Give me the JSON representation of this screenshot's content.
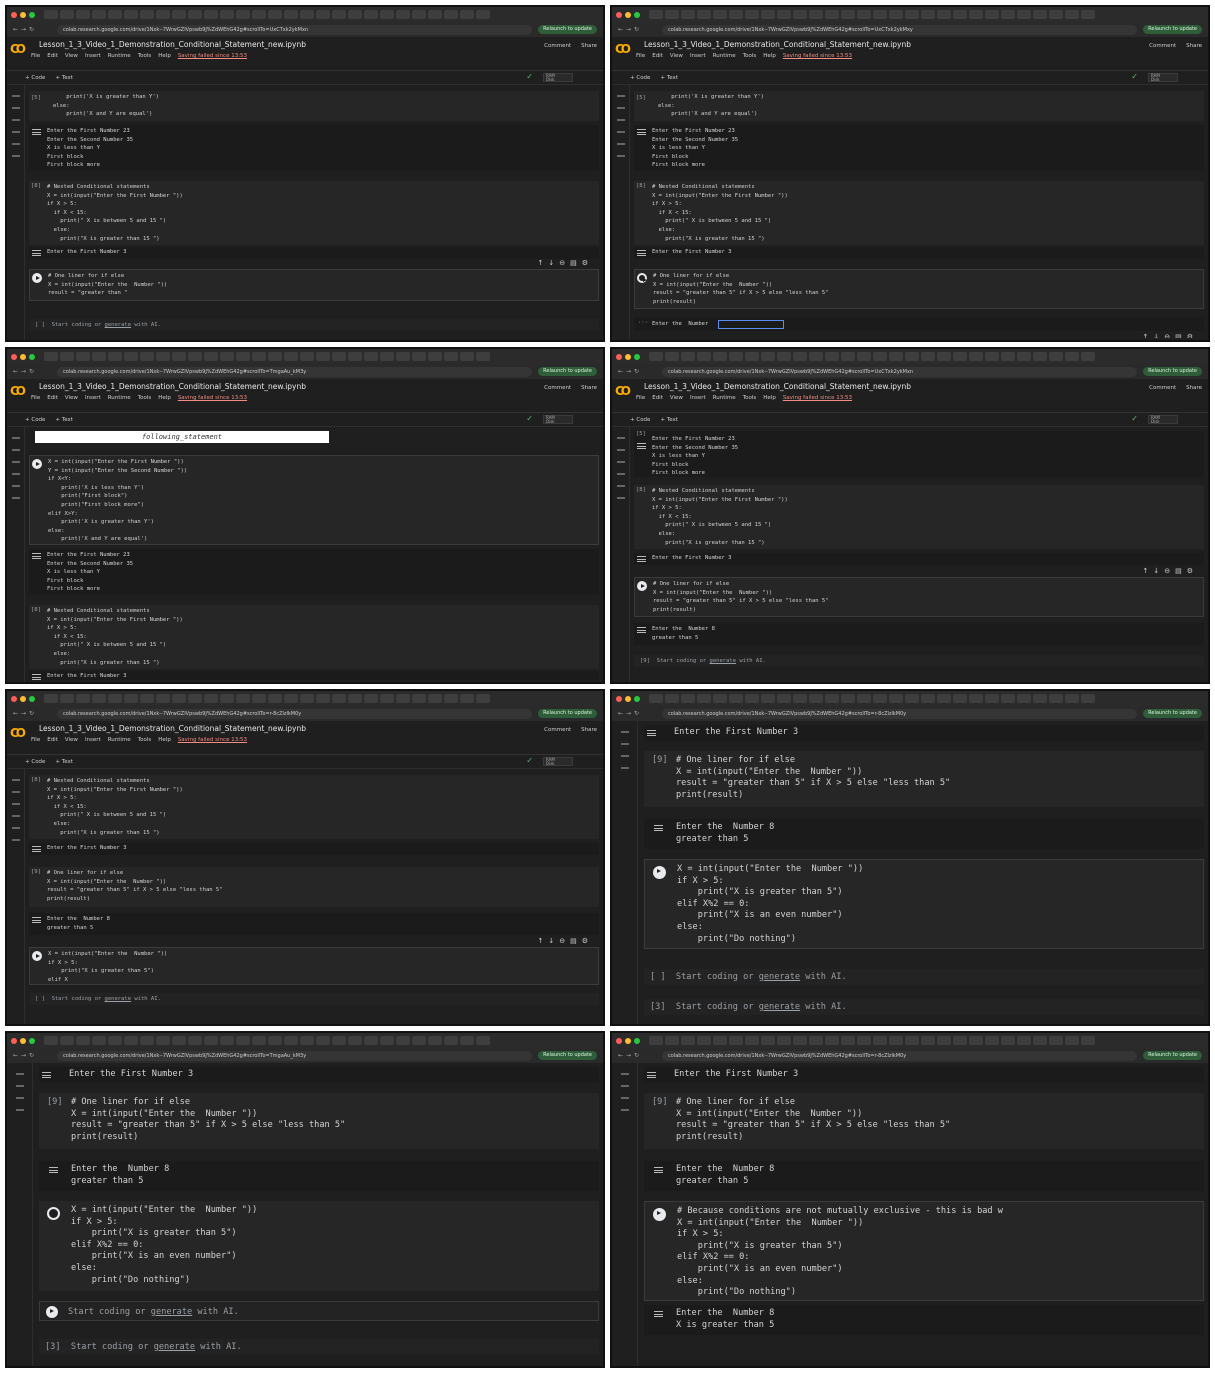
{
  "browser": {
    "relaunch_label": "Relaunch to update",
    "urls": [
      "colab.research.google.com/drive/1Nxk--7WrwGZIVpswb9J%ZdWEhG42g#scrollTo=UxCTxk2ykMxn",
      "colab.research.google.com/drive/1Nxk--7WrwGZIVpswb9J%ZdWEhG42g#scrollTo=UxCTxk2ykMxy",
      "colab.research.google.com/drive/1Nxk--7WrwGZIVpswb9J%ZdWEhG42g#scrollTo=TmgaAu_kM3y",
      "colab.research.google.com/drive/1Nxk--7WrwGZIVpswb9J%ZdWEhG42g#scrollTo=UxCTxk2ykMxn",
      "colab.research.google.com/drive/1Nxk--7WrwGZIVpswb9J%ZdWEhG42g#scrollTo=r-8cZlzlkM0y",
      "colab.research.google.com/drive/1Nxk--7WrwGZIVpswb9J%ZdWEhG42g#scrollTo=r-8cZlzlkM0y",
      "colab.research.google.com/drive/1Nxk--7WrwGZIVpswb9J%ZdWEhG42g#scrollTo=TmgaAu_kM3y",
      "colab.research.google.com/drive/1Nxk--7WrwGZIVpswb9J%ZdWEhG42g#scrollTo=r-8cZlzlkM0y"
    ]
  },
  "colab": {
    "notebook_title": "Lesson_1_3_Video_1_Demonstration_Conditional_Statement_new.ipynb",
    "menu": [
      "File",
      "Edit",
      "View",
      "Insert",
      "Runtime",
      "Tools",
      "Help"
    ],
    "save_warning": "Saving failed since 13:53",
    "comment_label": "Comment",
    "share_label": "Share",
    "add_code": "+ Code",
    "add_text": "+ Text",
    "ram_label": "RAM",
    "disk_label": "Disk",
    "ai_placeholder_pre": "Start coding or ",
    "ai_placeholder_link": "generate",
    "ai_placeholder_post": " with AI.",
    "following_statement": "following_statement"
  },
  "code": {
    "ifelse_tail": "    print('X is greater than Y')\nelse:\n    print('X and Y are equal')",
    "ifelse_full": "X = int(input(\"Enter the First Number \"))\nY = int(input(\"Enter the Second Number \"))\nif X<Y:\n    print('X is less than Y')\n    print(\"First block\")\n    print(\"First block more\")\nelif X>Y:\n    print('X is greater than Y')\nelse:\n    print('X and Y are equal')",
    "ifelse_output": "Enter the First Number 23\nEnter the Second Number 35\nX is less than Y\nFirst block\nFirst block more",
    "nested": "# Nested Conditional statements\nX = int(input(\"Enter the First Number \"))\nif X > 5:\n  if X < 15:\n    print(\" X is between 5 and 15 \")\n  else:\n    print(\"X is greater than 15 \")",
    "nested_output": "Enter the First Number 3",
    "oneliner_partial": "# One liner for if else\nX = int(input(\"Enter the  Number \"))\nresult = \"greater than \"",
    "oneliner": "# One liner for if else\nX = int(input(\"Enter the  Number \"))\nresult = \"greater than 5\" if X > 5 else \"less than 5\"\nprint(result)",
    "oneliner_prompt": "Enter the  Number",
    "oneliner_output": "Enter the  Number 8\ngreater than 5",
    "elif_partial": "X = int(input(\"Enter the  Number \"))\nif X > 5:\n    print(\"X is greater than 5\")\nelif X",
    "elif_full": "X = int(input(\"Enter the  Number \"))\nif X > 5:\n    print(\"X is greater than 5\")\nelif X%2 == 0:\n    print(\"X is an even number\")\nelse:\n    print(\"Do nothing\")",
    "elif_commented": "# Because conditions are not mutually exclusive - this is bad w\nX = int(input(\"Enter the  Number \"))\nif X > 5:\n    print(\"X is greater than 5\")\nelif X%2 == 0:\n    print(\"X is an even number\")\nelse:\n    print(\"Do nothing\")",
    "elif_output": "Enter the  Number 8\nX is greater than 5"
  },
  "counts": {
    "c5": "[5]",
    "c8": "[8]",
    "c9": "[9]",
    "c3": "[3]",
    "empty": "[ ]"
  },
  "colors": {
    "background": "#1f1f1f",
    "code_cell": "#262626",
    "accent_logo": "#f9ab00",
    "relaunch": "#2f5d3a",
    "input_border": "#5b8def",
    "warning": "#f28b82"
  }
}
